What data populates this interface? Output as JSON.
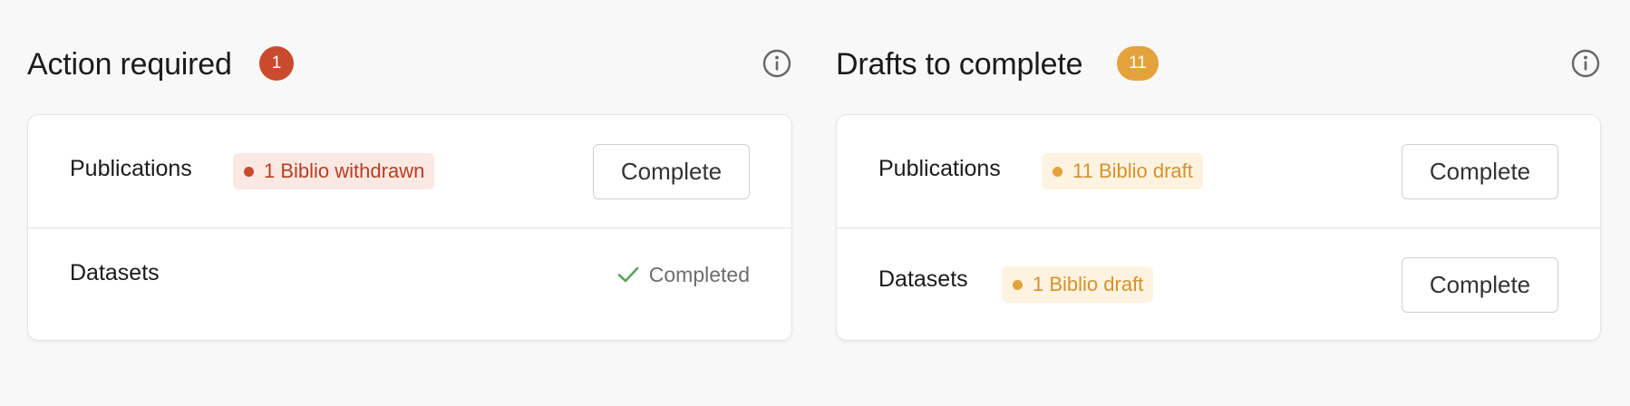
{
  "action_required": {
    "title": "Action required",
    "count": "1",
    "rows": [
      {
        "label": "Publications",
        "badge": "1 Biblio withdrawn",
        "button": "Complete"
      },
      {
        "label": "Datasets",
        "status": "Completed"
      }
    ]
  },
  "drafts": {
    "title": "Drafts to complete",
    "count": "11",
    "rows": [
      {
        "label": "Publications",
        "badge": "11 Biblio draft",
        "button": "Complete"
      },
      {
        "label": "Datasets",
        "badge": "1 Biblio draft",
        "button": "Complete"
      }
    ]
  },
  "colors": {
    "danger": "#c94a2c",
    "warning": "#e3a23a",
    "success": "#5fa35a"
  },
  "icons": {
    "info": "info-circle-icon",
    "check": "check-icon",
    "dot": "status-dot-icon"
  }
}
